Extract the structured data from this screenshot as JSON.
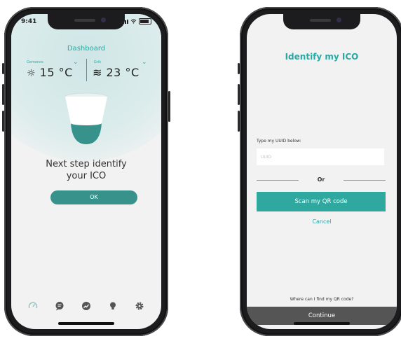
{
  "left_phone": {
    "status_time": "9:41",
    "header_title": "Dashboard",
    "locations": [
      {
        "name": "Gemenos",
        "temperature": "15 °C",
        "icon": "sun-icon"
      },
      {
        "name": "Grik",
        "temperature": "23 °C",
        "icon": "waves-icon"
      }
    ],
    "message": "Next step identify your ICO",
    "ok_label": "OK",
    "tabs": [
      {
        "name": "dashboard",
        "icon": "gauge-icon"
      },
      {
        "name": "chat",
        "icon": "chat-bubble-icon"
      },
      {
        "name": "stats",
        "icon": "trend-icon"
      },
      {
        "name": "tips",
        "icon": "lightbulb-icon"
      },
      {
        "name": "settings",
        "icon": "gear-icon"
      }
    ],
    "colors": {
      "accent": "#2aa9a2",
      "button": "#37928c",
      "cup_teal": "#37928c"
    }
  },
  "right_phone": {
    "title": "Identify my ICO",
    "uuid_label": "Type my UUID below:",
    "uuid_placeholder": "UUID",
    "uuid_value": "",
    "or_label": "Or",
    "scan_label": "Scan my QR code",
    "cancel_label": "Cancel",
    "where_label": "Where can I find my QR code?",
    "continue_label": "Continue",
    "colors": {
      "accent": "#2aa9a2",
      "scan_button": "#2fa99f",
      "continue_button": "#555555"
    }
  }
}
